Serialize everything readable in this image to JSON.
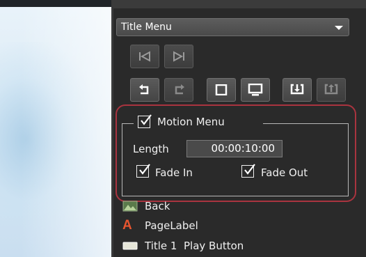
{
  "menu_selector": {
    "value": "Title Menu"
  },
  "toolbar": {
    "buttons_row1": [
      "first-page-icon",
      "last-page-icon"
    ],
    "buttons_row2": [
      "undo-icon",
      "redo-icon",
      "square-icon",
      "monitor-icon",
      "import-icon",
      "export-icon"
    ]
  },
  "motion_menu": {
    "label": "Motion Menu",
    "checked": true,
    "length_label": "Length",
    "length_value": "00:00:10:00",
    "fade_in": {
      "label": "Fade In",
      "checked": true
    },
    "fade_out": {
      "label": "Fade Out",
      "checked": true
    }
  },
  "layers": [
    {
      "icon": "image-icon",
      "label": "Back"
    },
    {
      "icon": "text-label-icon",
      "label": "PageLabel"
    },
    {
      "icon": "button-icon",
      "label": "Title 1  Play Button"
    }
  ],
  "colors": {
    "panel_bg": "#2a2a2a",
    "highlight_frame": "#a9343f",
    "text_label_icon": "#e8552f"
  }
}
